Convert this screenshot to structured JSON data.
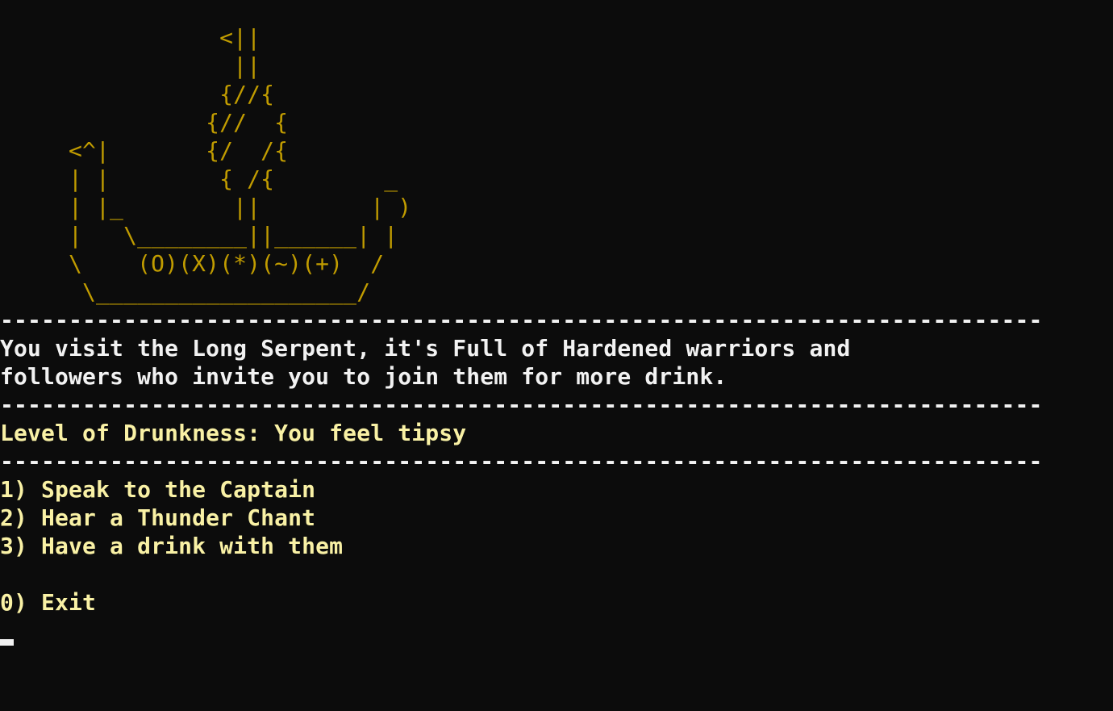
{
  "ship_art": [
    "                <||",
    "                 ||",
    "                {//{",
    "               {//  {",
    "     <^|       {/  /{",
    "     | |        { /{        _",
    "     | |_        ||        | )",
    "     |   \\________||______| |",
    "     \\    (O)(X)(*)(~)(+)  /",
    "      \\___________________/"
  ],
  "separator": "----------------------------------------------------------------------------",
  "description": [
    "You visit the Long Serpent, it's Full of Hardened warriors and",
    "followers who invite you to join them for more drink."
  ],
  "drunkness": "Level of Drunkness: You feel tipsy",
  "options": [
    "1) Speak to the Captain",
    "2) Hear a Thunder Chant",
    "3) Have a drink with them"
  ],
  "exit_option": "0) Exit",
  "colors": {
    "background": "#0c0c0c",
    "art": "#c19c00",
    "text": "#f2f2f2",
    "highlight": "#f9f1a5"
  }
}
